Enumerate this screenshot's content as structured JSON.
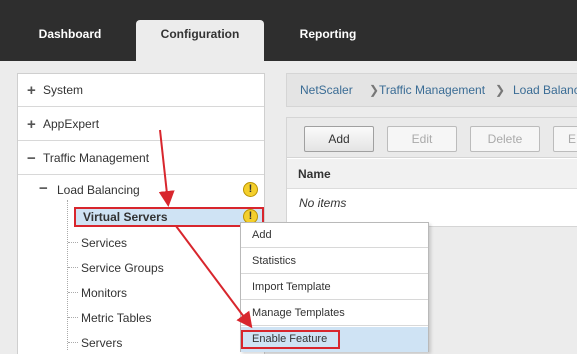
{
  "topnav": {
    "tabs": [
      "Dashboard",
      "Configuration",
      "Reporting"
    ],
    "active": "Configuration"
  },
  "tree": {
    "items": [
      "System",
      "AppExpert",
      "Traffic Management"
    ],
    "load_balancing": "Load Balancing",
    "selected": "Virtual Servers",
    "children": [
      "Services",
      "Service Groups",
      "Monitors",
      "Metric Tables",
      "Servers"
    ],
    "warning_glyph": "!"
  },
  "breadcrumb": [
    "NetScaler",
    "Traffic Management",
    "Load Balanc"
  ],
  "toolbar": {
    "add": "Add",
    "edit": "Edit",
    "delete": "Delete",
    "more": "E"
  },
  "table": {
    "column": "Name",
    "empty": "No items"
  },
  "context_menu": {
    "items": [
      "Add",
      "Statistics",
      "Import Template",
      "Manage Templates",
      "Enable Feature"
    ],
    "highlighted": "Enable Feature"
  },
  "colors": {
    "annotation_red": "#d8262d",
    "selection_blue": "#cfe3f4",
    "warning_yellow": "#f4cf2b",
    "link_blue": "#3a6c95"
  }
}
